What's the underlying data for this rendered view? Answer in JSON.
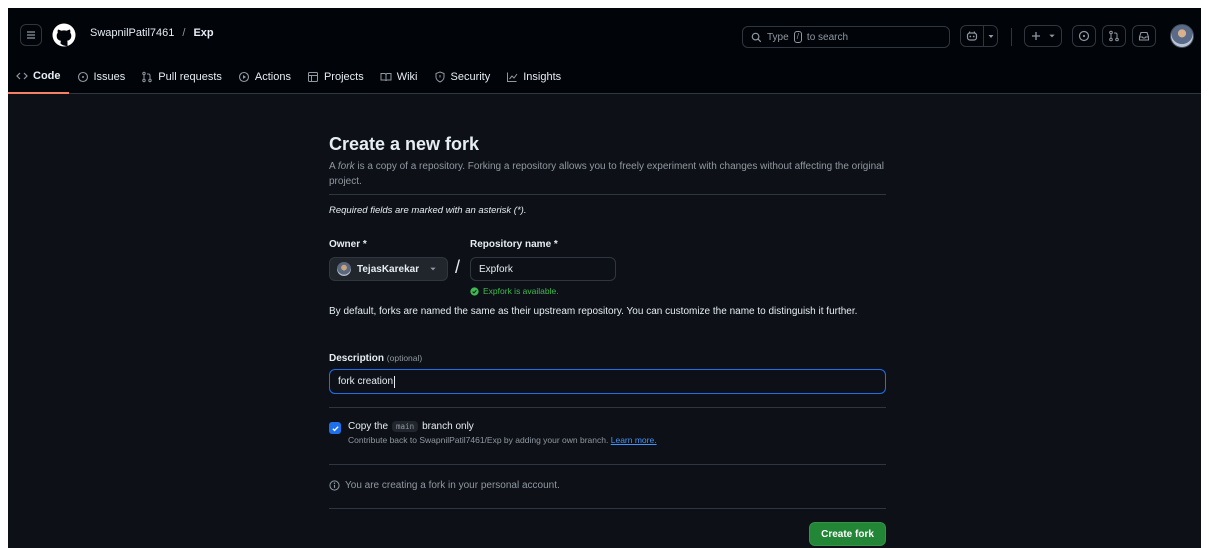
{
  "header": {
    "owner": "SwapnilPatil7461",
    "separator": "/",
    "repo": "Exp",
    "search": {
      "prefix": "Type",
      "key": "/",
      "suffix": "to search"
    }
  },
  "tabs": [
    {
      "label": "Code",
      "icon": "code-icon",
      "selected": true
    },
    {
      "label": "Issues",
      "icon": "issue-opened-icon"
    },
    {
      "label": "Pull requests",
      "icon": "git-pull-request-icon"
    },
    {
      "label": "Actions",
      "icon": "play-icon"
    },
    {
      "label": "Projects",
      "icon": "table-icon"
    },
    {
      "label": "Wiki",
      "icon": "book-icon"
    },
    {
      "label": "Security",
      "icon": "shield-icon"
    },
    {
      "label": "Insights",
      "icon": "graph-icon"
    }
  ],
  "form": {
    "title": "Create a new fork",
    "lead_em": "fork",
    "lead_pre": "A ",
    "lead_post": " is a copy of a repository. Forking a repository allows you to freely experiment with changes without affecting the original project.",
    "required_note": "Required fields are marked with an asterisk (*).",
    "owner_label": "Owner *",
    "owner_value": "TejasKarekar",
    "repo_label": "Repository name *",
    "repo_value": "Expfork",
    "availability": "Expfork is available.",
    "naming_note": "By default, forks are named the same as their upstream repository. You can customize the name to distinguish it further.",
    "description_label": "Description",
    "description_optional": "(optional)",
    "description_value": "fork creation",
    "copy_pre": "Copy the",
    "copy_branch": "main",
    "copy_post": "branch only",
    "copy_checked": true,
    "copy_help": "Contribute back to SwapnilPatil7461/Exp by adding your own branch.",
    "learn_more": "Learn more.",
    "account_info": "You are creating a fork in your personal account.",
    "submit_label": "Create fork"
  },
  "colors": {
    "accent": "#1f6feb",
    "success": "#238636",
    "success_text": "#3fb950",
    "tab_underline": "#f78166"
  }
}
